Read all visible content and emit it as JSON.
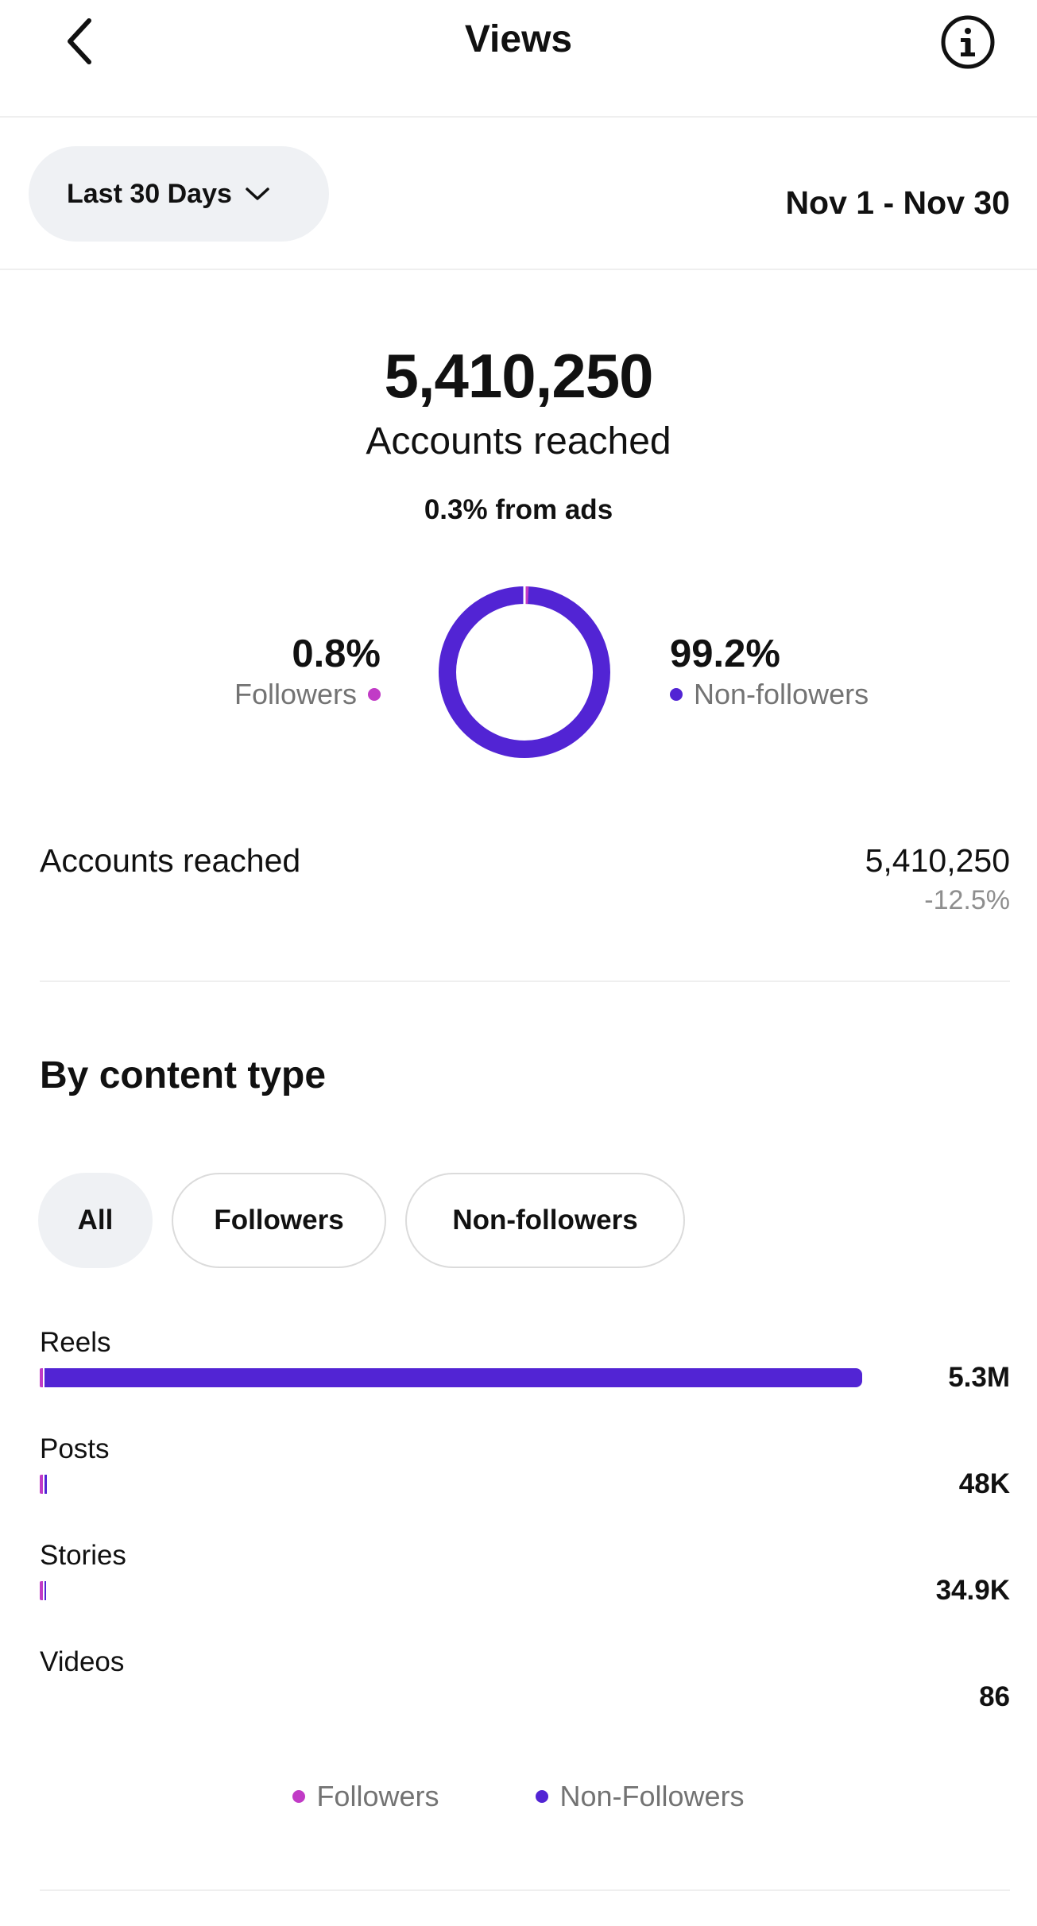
{
  "header": {
    "title": "Views",
    "back_icon": "chevron-left-icon",
    "info_icon": "info-circle-icon"
  },
  "range": {
    "selected": "Last 30 Days",
    "dates": "Nov 1 - Nov 30"
  },
  "summary": {
    "total": "5,410,250",
    "label": "Accounts reached",
    "ads": "0.3% from ads"
  },
  "audience_split": {
    "followers_pct": "0.8%",
    "followers_label": "Followers",
    "non_followers_pct": "99.2%",
    "non_followers_label": "Non-followers",
    "followers_fraction": 0.008,
    "non_followers_fraction": 0.992
  },
  "accounts_row": {
    "label": "Accounts reached",
    "value": "5,410,250",
    "change": "-12.5%"
  },
  "content_type": {
    "title": "By content type",
    "filters": [
      "All",
      "Followers",
      "Non-followers"
    ],
    "selected_filter": "All",
    "rows": [
      {
        "label": "Reels",
        "value": "5.3M",
        "amount": 5300000
      },
      {
        "label": "Posts",
        "value": "48K",
        "amount": 48000
      },
      {
        "label": "Stories",
        "value": "34.9K",
        "amount": 34900
      },
      {
        "label": "Videos",
        "value": "86",
        "amount": 86
      }
    ],
    "legend": [
      "Followers",
      "Non-Followers"
    ]
  },
  "colors": {
    "followers": "#c13bc6",
    "non_followers": "#5224d4",
    "chip_bg": "#eff1f4",
    "muted_text": "#737373"
  }
}
